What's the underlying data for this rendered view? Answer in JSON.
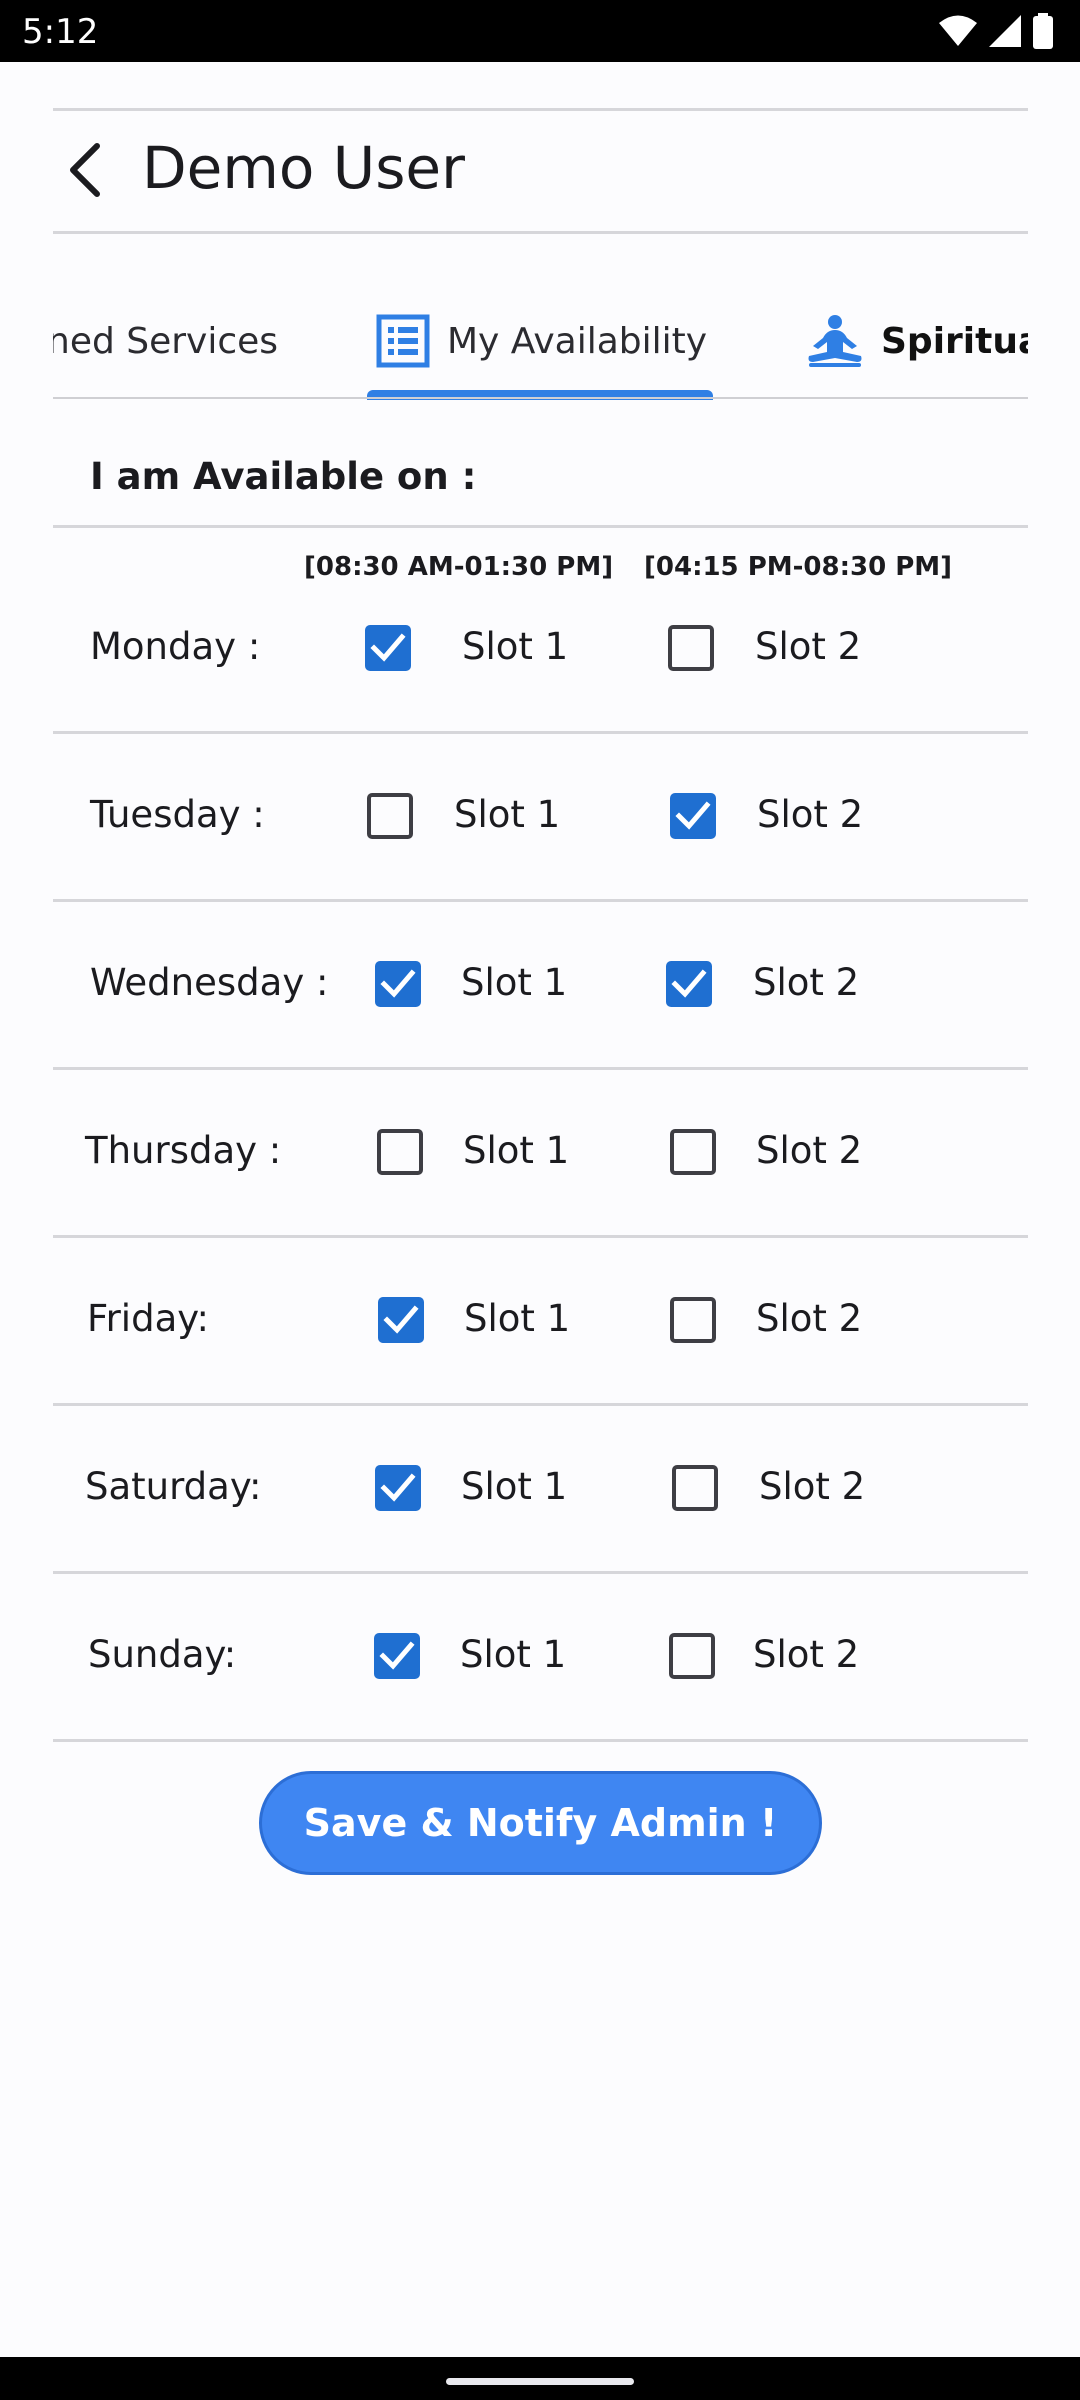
{
  "status_bar": {
    "time": "5:12",
    "icons": [
      "wifi-icon",
      "cellular-signal-icon",
      "battery-icon"
    ]
  },
  "header": {
    "title": "Demo User",
    "back_icon": "chevron-left-icon"
  },
  "tabs": [
    {
      "label": "ned Services",
      "icon": "none",
      "active": false
    },
    {
      "label": "My Availability",
      "icon": "list-icon",
      "active": true
    },
    {
      "label": "Spiritua",
      "icon": "meditation-icon",
      "active": false
    }
  ],
  "availability": {
    "title": "I am Available on :",
    "slot1_time": "[08:30 AM-01:30 PM]",
    "slot2_time": "[04:15 PM-08:30 PM]",
    "days": [
      {
        "label": "Monday :",
        "slot1": true,
        "slot2": false,
        "slot1_label": "Slot 1",
        "slot2_label": "Slot 2"
      },
      {
        "label": "Tuesday :",
        "slot1": false,
        "slot2": true,
        "slot1_label": "Slot 1",
        "slot2_label": "Slot 2"
      },
      {
        "label": "Wednesday :",
        "slot1": true,
        "slot2": true,
        "slot1_label": "Slot 1",
        "slot2_label": "Slot 2"
      },
      {
        "label": "Thursday :",
        "slot1": false,
        "slot2": false,
        "slot1_label": "Slot 1",
        "slot2_label": "Slot 2"
      },
      {
        "label": "Friday:",
        "slot1": true,
        "slot2": false,
        "slot1_label": "Slot 1",
        "slot2_label": "Slot 2"
      },
      {
        "label": "Saturday:",
        "slot1": true,
        "slot2": false,
        "slot1_label": "Slot 1",
        "slot2_label": "Slot 2"
      },
      {
        "label": "Sunday:",
        "slot1": true,
        "slot2": false,
        "slot1_label": "Slot 1",
        "slot2_label": "Slot 2"
      }
    ]
  },
  "save_button": {
    "label": "Save & Notify Admin !"
  },
  "colors": {
    "accent": "#2f7fe4",
    "checkbox_checked": "#1f6fd1",
    "button": "#3f86f2"
  }
}
